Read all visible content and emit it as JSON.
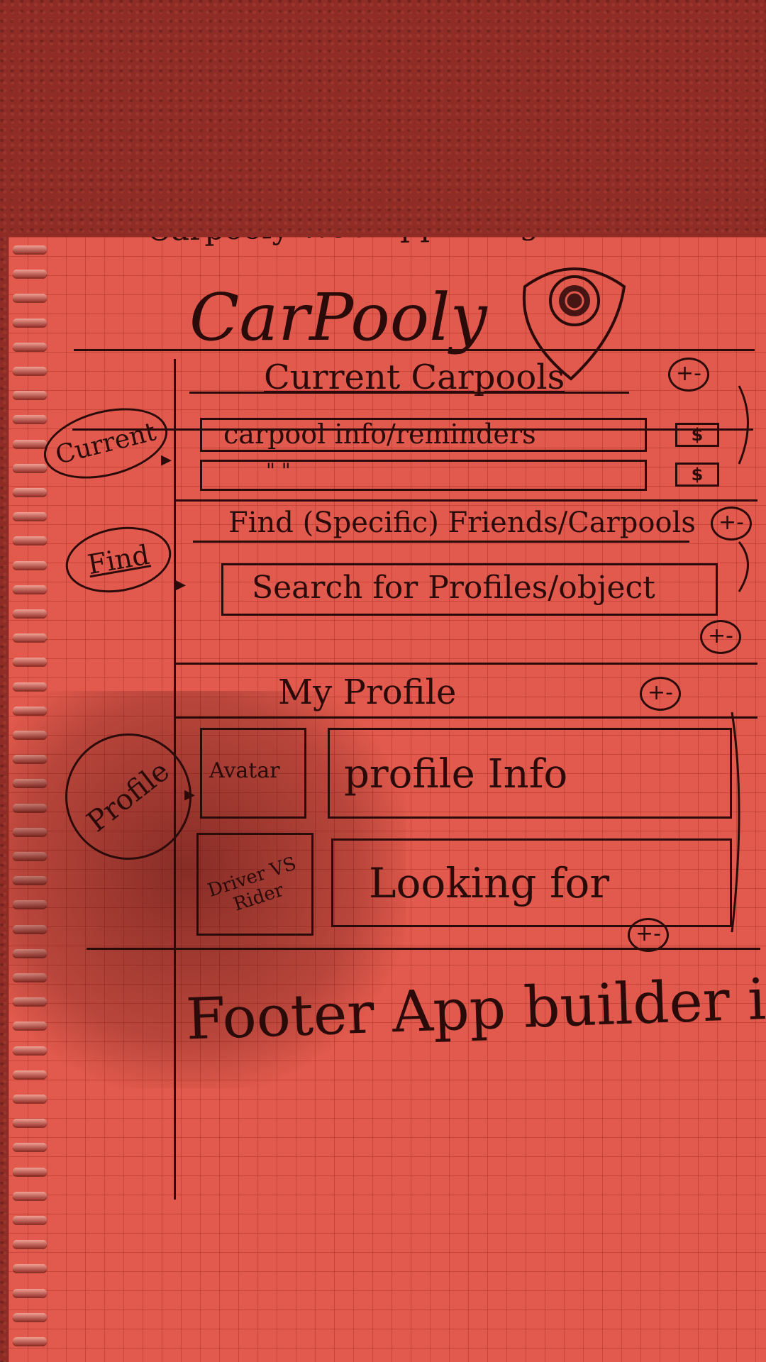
{
  "sketch": {
    "title": "Carpooly Web.App Design",
    "logo_text": "CarPooly",
    "sections": {
      "current": {
        "side_label": "Current",
        "heading": "Current Carpools",
        "toggle": "+-",
        "rows": [
          {
            "text": "carpool info/reminders",
            "badge": "$"
          },
          {
            "text": "\"        \"",
            "badge": "$"
          }
        ]
      },
      "find": {
        "side_label": "Find",
        "heading": "Find (Specific) Friends/Carpools",
        "toggle": "+-",
        "search_box": "Search for Profiles/object",
        "toggle_bottom": "+-"
      },
      "profile": {
        "side_label": "Profile",
        "heading": "My Profile",
        "toggle": "+-",
        "avatar_box": "Avatar",
        "info_box": "profile Info",
        "role_box": "Driver VS Rider",
        "looking_box": "Looking for",
        "toggle_bottom": "+-"
      }
    },
    "footer": "Footer App builder info"
  }
}
